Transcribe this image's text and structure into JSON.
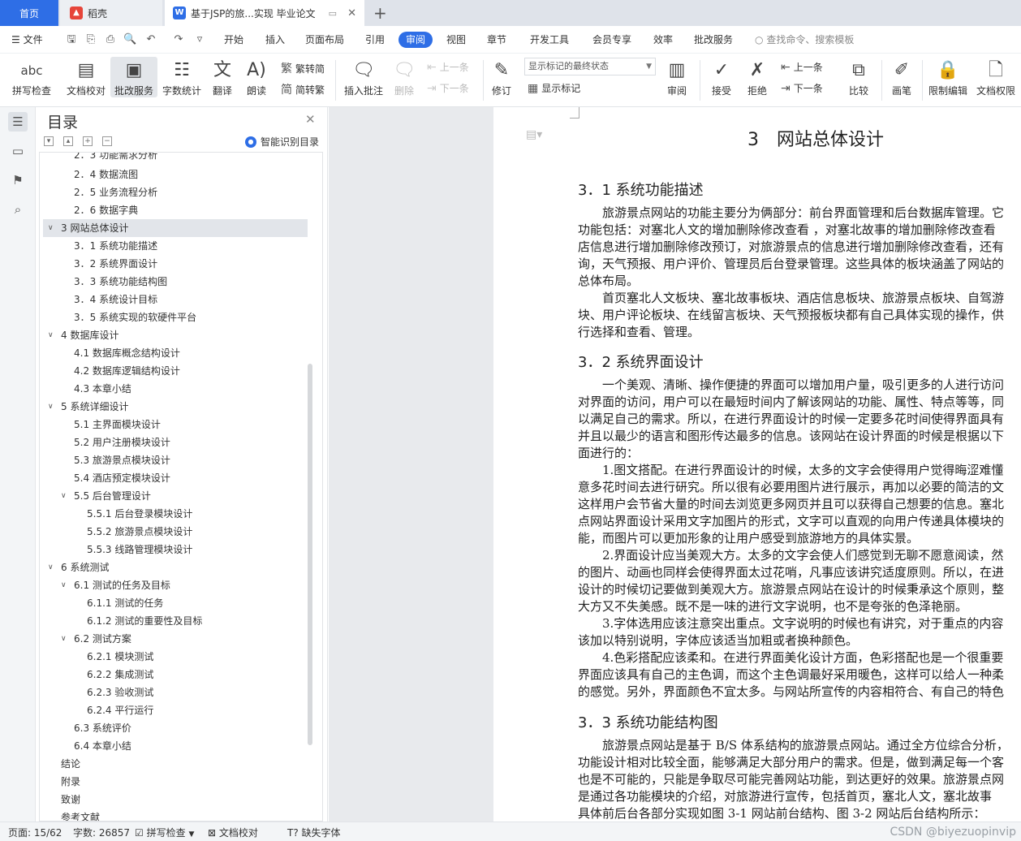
{
  "tabs": {
    "home": "首页",
    "daoke": "稻壳",
    "doc": "基于JSP的旅...实现 毕业论文"
  },
  "menu": {
    "file": "文件",
    "items": [
      "开始",
      "插入",
      "页面布局",
      "引用",
      "审阅",
      "视图",
      "章节",
      "开发工具",
      "会员专享",
      "效率",
      "批改服务"
    ],
    "active": "审阅",
    "search": "查找命令、搜索模板"
  },
  "ribbon": {
    "spell": "拼写检查",
    "proof": "文档校对",
    "grade": "批改服务",
    "wordcount": "字数统计",
    "translate": "翻译",
    "read": "朗读",
    "trad": "繁转简",
    "simp": "简转繁",
    "insert_comment": "插入批注",
    "delete": "删除",
    "prev": "上一条",
    "next": "下一条",
    "track": "修订",
    "markup_state": "显示标记的最终状态",
    "show_markup": "显示标记",
    "review": "审阅",
    "accept": "接受",
    "reject": "拒绝",
    "prev2": "上一条",
    "next2": "下一条",
    "compare": "比较",
    "pen": "画笔",
    "restrict": "限制编辑",
    "permission": "文档权限"
  },
  "toc": {
    "title": "目录",
    "smart": "智能识别目录",
    "items": [
      "2．3 功能需求分析",
      "2．4 数据流图",
      "2．5 业务流程分析",
      "2．6 数据字典",
      "3 网站总体设计",
      "3．1 系统功能描述",
      "3．2 系统界面设计",
      "3．3 系统功能结构图",
      "3．4 系统设计目标",
      "3．5 系统实现的软硬件平台",
      "4 数据库设计",
      "4.1 数据库概念结构设计",
      "4.2 数据库逻辑结构设计",
      "4.3 本章小结",
      "5 系统详细设计",
      "5.1 主界面模块设计",
      "5.2 用户注册模块设计",
      "5.3 旅游景点模块设计",
      "5.4 酒店预定模块设计",
      "5.5 后台管理设计",
      "5.5.1 后台登录模块设计",
      "5.5.2 旅游景点模块设计",
      "5.5.3 线路管理模块设计",
      "6 系统测试",
      "6.1 测试的任务及目标",
      "6.1.1 测试的任务",
      "6.1.2 测试的重要性及目标",
      "6.2 测试方案",
      "6.2.1 模块测试",
      "6.2.2 集成测试",
      "6.2.3 验收测试",
      "6.2.4 平行运行",
      "6.3 系统评价",
      "6.4 本章小结",
      "结论",
      "附录",
      "致谢",
      "参考文献"
    ]
  },
  "doc": {
    "chapter": "3　网站总体设计",
    "s1": "3．1 系统功能描述",
    "s2": "3．2 系统界面设计",
    "s3": "3．3 系统功能结构图",
    "p1": [
      "　　旅游景点网站的功能主要分为俩部分：前台界面管理和后台数据库管理。它",
      "功能包括：对塞北人文的增加删除修改查看 ，对塞北故事的增加删除修改查看",
      "店信息进行增加删除修改预订，对旅游景点的信息进行增加删除修改查看，还有",
      "询，天气预报、用户评价、管理员后台登录管理。这些具体的板块涵盖了网站的",
      "总体布局。",
      "　　首页塞北人文板块、塞北故事板块、酒店信息板块、旅游景点板块、自驾游",
      "块、用户评论板块、在线留言板块、天气预报板块都有自己具体实现的操作，供",
      "行选择和查看、管理。"
    ],
    "p2": [
      "　　一个美观、清晰、操作便捷的界面可以增加用户量，吸引更多的人进行访问",
      "对界面的访问，用户可以在最短时间内了解该网站的功能、属性、特点等等，同",
      "以满足自己的需求。所以，在进行界面设计的时候一定要多花时间使得界面具有",
      "并且以最少的语言和图形传达最多的信息。该网站在设计界面的时候是根据以下",
      "面进行的：",
      "　　1.图文搭配。在进行界面设计的时候，太多的文字会使得用户觉得晦涩难懂",
      "意多花时间去进行研究。所以很有必要用图片进行展示，再加以必要的简洁的文",
      "这样用户会节省大量的时间去浏览更多网页并且可以获得自己想要的信息。塞北",
      "点网站界面设计采用文字加图片的形式，文字可以直观的向用户传递具体模块的",
      "能，而图片可以更加形象的让用户感受到旅游地方的具体实景。",
      "　　2.界面设计应当美观大方。太多的文字会使人们感觉到无聊不愿意阅读，然",
      "的图片、动画也同样会使得界面太过花哨，凡事应该讲究适度原则。所以，在进",
      "设计的时候切记要做到美观大方。旅游景点网站在设计的时候秉承这个原则，整",
      "大方又不失美感。既不是一味的进行文字说明，也不是夸张的色泽艳丽。",
      "　　3.字体选用应该注意突出重点。文字说明的时候也有讲究，对于重点的内容",
      "该加以特别说明，字体应该适当加粗或者换种颜色。",
      "　　4.色彩搭配应该柔和。在进行界面美化设计方面，色彩搭配也是一个很重要",
      "界面应该具有自己的主色调，而这个主色调最好采用暖色，这样可以给人一种柔",
      "的感觉。另外，界面颜色不宜太多。与网站所宣传的内容相符合、有自己的特色"
    ],
    "p3": [
      "　　旅游景点网站是基于 B/S 体系结构的旅游景点网站。通过全方位综合分析，",
      "功能设计相对比较全面，能够满足大部分用户的需求。但是，做到满足每一个客",
      "也是不可能的，只能是争取尽可能完善网站功能，到达更好的效果。旅游景点网",
      "是通过各功能模块的介绍，对旅游进行宣传，包括首页，塞北人文，塞北故事",
      "具体前后台各部分实现如图 3-1 网站前台结构、图 3-2 网站后台结构所示："
    ]
  },
  "status": {
    "page": "页面: 15/62",
    "words": "字数: 26857",
    "spell": "拼写检查",
    "proof": "文档校对",
    "font": "缺失字体",
    "watermark": "CSDN @biyezuopinvip"
  }
}
